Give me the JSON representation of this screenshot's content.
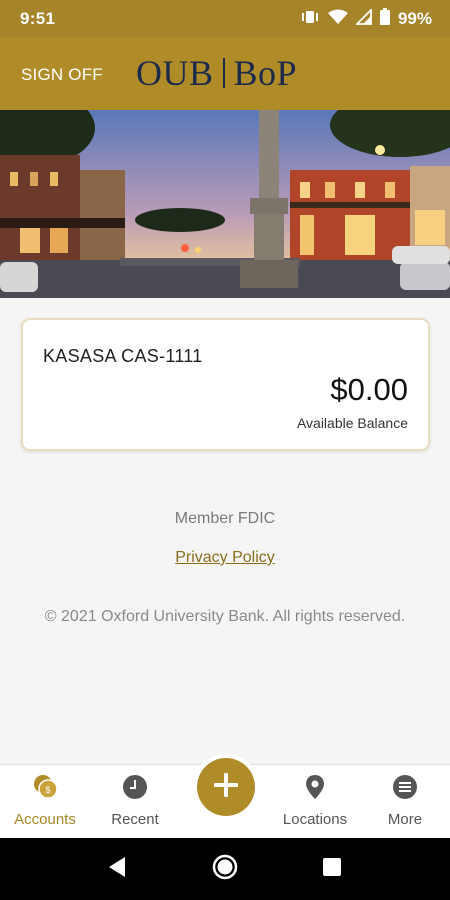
{
  "status_bar": {
    "time": "9:51",
    "battery": "99%",
    "icons": [
      "vibrate-icon",
      "wifi-icon",
      "signal-icon",
      "battery-icon"
    ]
  },
  "header": {
    "sign_off": "SIGN OFF",
    "logo_left": "OUB",
    "logo_right": "BoP"
  },
  "account": {
    "name": "KASASA CAS-1111",
    "balance": "$0.00",
    "balance_label": "Available Balance"
  },
  "footer": {
    "fdic": "Member FDIC",
    "privacy": "Privacy Policy",
    "copyright": "© 2021 Oxford University Bank. All rights reserved."
  },
  "nav": {
    "items": [
      {
        "label": "Accounts",
        "icon": "coins-icon"
      },
      {
        "label": "Recent",
        "icon": "clock-icon"
      },
      {
        "label": "Locations",
        "icon": "location-pin-icon"
      },
      {
        "label": "More",
        "icon": "menu-icon"
      }
    ],
    "accounts_badge": "$",
    "fab_icon": "plus-icon"
  },
  "colors": {
    "brand_gold": "#b08c28",
    "status_gold": "#a5842a",
    "logo_navy": "#1c2b4c"
  }
}
